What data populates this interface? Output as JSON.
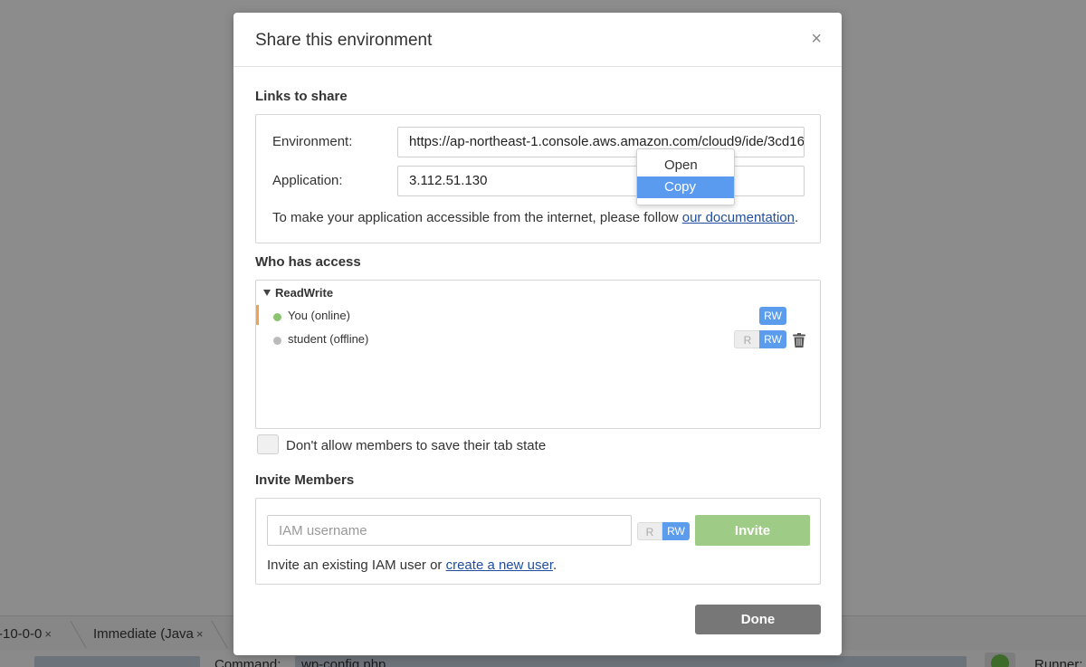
{
  "modal": {
    "title": "Share this environment",
    "close_icon": "×",
    "done_label": "Done"
  },
  "links": {
    "section_title": "Links to share",
    "environment_label": "Environment:",
    "environment_value": "https://ap-northeast-1.console.aws.amazon.com/cloud9/ide/3cd16",
    "application_label": "Application:",
    "application_value": "3.112.51.130",
    "note_text": "To make your application accessible from the internet, please follow ",
    "note_link": "our documentation",
    "note_end": "."
  },
  "context_menu": {
    "items": [
      {
        "label": "Open",
        "active": false
      },
      {
        "label": "Copy",
        "active": true
      }
    ]
  },
  "access": {
    "section_title": "Who has access",
    "group_name": "ReadWrite",
    "members": [
      {
        "name": "You (online)",
        "status_color": "#8cc56f",
        "perm": "RW"
      },
      {
        "name": "student (offline)",
        "status_color": "#bbbbbb",
        "perm_r": "R",
        "perm_rw": "RW"
      }
    ]
  },
  "tab_state": {
    "label": "Don't allow members to save their tab state"
  },
  "invite": {
    "section_title": "Invite Members",
    "placeholder": "IAM username",
    "perm_r": "R",
    "perm_rw": "RW",
    "button_label": "Invite",
    "note_text": "Invite an existing IAM user or ",
    "note_link": "create a new user",
    "note_end": "."
  },
  "background": {
    "tab1": "-10-0-0",
    "tab2": "Immediate (Java",
    "tab_close": "×",
    "command_label": "Command:",
    "command_value": "wp-config.php",
    "runner_label": "Runner:"
  },
  "colors": {
    "accent_blue": "#5c9cec",
    "invite_green": "#9ecb85",
    "online_green": "#8cc56f",
    "active_marker": "#f5a04a"
  }
}
